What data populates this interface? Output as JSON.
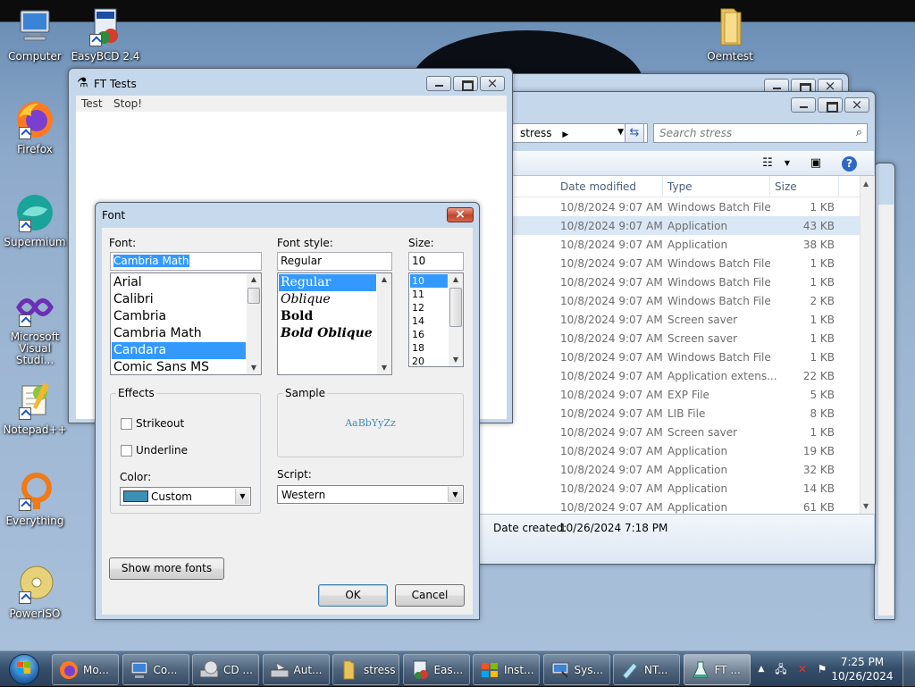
{
  "desktop": {
    "icons": [
      {
        "label": "Computer",
        "icon": "computer-icon"
      },
      {
        "label": "EasyBCD 2.4",
        "icon": "easybcd-icon"
      },
      {
        "label": "Oemtest",
        "icon": "folder-icon"
      },
      {
        "label": "Firefox",
        "icon": "firefox-icon"
      },
      {
        "label": "Supermium",
        "icon": "supermium-icon"
      },
      {
        "label": "Microsoft Visual Studi...",
        "icon": "visual-studio-icon"
      },
      {
        "label": "Notepad++",
        "icon": "notepadpp-icon"
      },
      {
        "label": "Everything",
        "icon": "everything-icon"
      },
      {
        "label": "PowerISO",
        "icon": "poweriso-icon"
      }
    ]
  },
  "explorer": {
    "address": "stress",
    "search_placeholder": "Search stress",
    "columns": [
      "Date modified",
      "Type",
      "Size"
    ],
    "rows": [
      {
        "date": "10/8/2024 9:07 AM",
        "type": "Windows Batch File",
        "size": "1 KB"
      },
      {
        "date": "10/8/2024 9:07 AM",
        "type": "Application",
        "size": "43 KB"
      },
      {
        "date": "10/8/2024 9:07 AM",
        "type": "Application",
        "size": "38 KB"
      },
      {
        "date": "10/8/2024 9:07 AM",
        "type": "Windows Batch File",
        "size": "1 KB"
      },
      {
        "date": "10/8/2024 9:07 AM",
        "type": "Windows Batch File",
        "size": "1 KB"
      },
      {
        "date": "10/8/2024 9:07 AM",
        "type": "Windows Batch File",
        "size": "2 KB"
      },
      {
        "date": "10/8/2024 9:07 AM",
        "type": "Screen saver",
        "size": "1 KB"
      },
      {
        "date": "10/8/2024 9:07 AM",
        "type": "Screen saver",
        "size": "1 KB"
      },
      {
        "date": "10/8/2024 9:07 AM",
        "type": "Windows Batch File",
        "size": "1 KB"
      },
      {
        "date": "10/8/2024 9:07 AM",
        "type": "Application extens...",
        "size": "22 KB"
      },
      {
        "date": "10/8/2024 9:07 AM",
        "type": "EXP File",
        "size": "5 KB"
      },
      {
        "date": "10/8/2024 9:07 AM",
        "type": "LIB File",
        "size": "8 KB"
      },
      {
        "date": "10/8/2024 9:07 AM",
        "type": "Screen saver",
        "size": "1 KB"
      },
      {
        "date": "10/8/2024 9:07 AM",
        "type": "Application",
        "size": "19 KB"
      },
      {
        "date": "10/8/2024 9:07 AM",
        "type": "Application",
        "size": "32 KB"
      },
      {
        "date": "10/8/2024 9:07 AM",
        "type": "Application",
        "size": "14 KB"
      },
      {
        "date": "10/8/2024 9:07 AM",
        "type": "Application",
        "size": "61 KB"
      }
    ],
    "selected_row": 1,
    "details_label": "Date created:",
    "details_value": "10/26/2024 7:18 PM"
  },
  "ft_tests": {
    "title": "FT Tests",
    "menu": [
      "Test",
      "Stop!"
    ]
  },
  "font_dialog": {
    "title": "Font",
    "font_label": "Font:",
    "font_value": "Cambria Math",
    "fonts": [
      "Arial",
      "Calibri",
      "Cambria",
      "Cambria Math",
      "Candara",
      "Comic Sans MS"
    ],
    "selected_font": 4,
    "style_label": "Font style:",
    "style_value": "Regular",
    "styles": [
      "Regular",
      "Oblique",
      "Bold",
      "Bold Oblique"
    ],
    "selected_style": 0,
    "size_label": "Size:",
    "size_value": "10",
    "sizes": [
      "10",
      "11",
      "12",
      "14",
      "16",
      "18",
      "20"
    ],
    "selected_size": 0,
    "effects_label": "Effects",
    "strikeout_label": "Strikeout",
    "strikeout_checked": false,
    "underline_label": "Underline",
    "underline_checked": false,
    "color_label": "Color:",
    "color_value": "Custom",
    "color_swatch": "#3d8fb8",
    "sample_label": "Sample",
    "sample_text": "AaBbYyZz",
    "script_label": "Script:",
    "script_value": "Western",
    "more_fonts_label": "Show more fonts",
    "ok_label": "OK",
    "cancel_label": "Cancel"
  },
  "taskbar": {
    "items": [
      {
        "label": "Mo...",
        "icon": "firefox-icon"
      },
      {
        "label": "Co...",
        "icon": "computer-icon"
      },
      {
        "label": "CD ...",
        "icon": "cd-drive-icon"
      },
      {
        "label": "Aut...",
        "icon": "drive-icon"
      },
      {
        "label": "stress",
        "icon": "folder-icon"
      },
      {
        "label": "Eas...",
        "icon": "easybcd-icon"
      },
      {
        "label": "Inst...",
        "icon": "windows-icon"
      },
      {
        "label": "Sys...",
        "icon": "system-icon"
      },
      {
        "label": "NT...",
        "icon": "ntlite-icon"
      },
      {
        "label": "FT ...",
        "icon": "flask-icon"
      }
    ],
    "active_item": 9,
    "time": "7:25 PM",
    "date": "10/26/2024"
  }
}
